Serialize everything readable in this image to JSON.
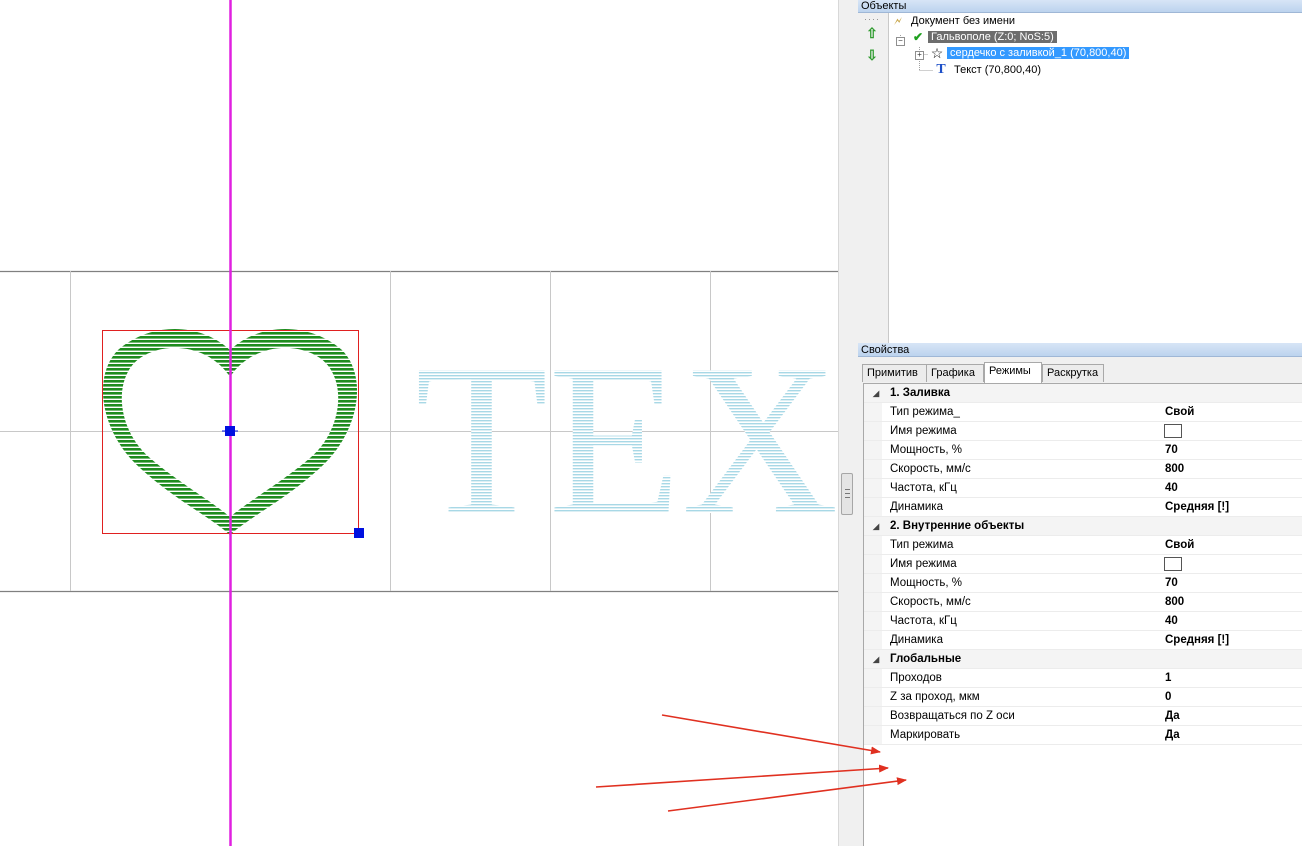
{
  "canvas": {
    "text_sample": "TEX"
  },
  "objects_panel": {
    "title": "Объекты",
    "tree": [
      {
        "label": "Документ без имени",
        "icon": "document-icon"
      },
      {
        "label": "Гальвополе (Z:0; NoS:5)",
        "icon": "checkmark-field-icon"
      },
      {
        "label": "сердечко с заливкой_1 (70,800,40)",
        "icon": "star-outline-icon"
      },
      {
        "label": "Текст (70,800,40)",
        "icon": "text-t-icon"
      }
    ]
  },
  "props_panel": {
    "title": "Свойства",
    "tabs": [
      "Примитив",
      "Графика",
      "Режимы",
      "Раскрутка"
    ],
    "active_tab": "Режимы",
    "rows": [
      {
        "type": "cat",
        "label": "1. Заливка"
      },
      {
        "type": "prop",
        "label": "Тип режима_",
        "value": "Свой"
      },
      {
        "type": "box",
        "label": "Имя режима",
        "value": ""
      },
      {
        "type": "prop",
        "label": "Мощность, %",
        "value": "70"
      },
      {
        "type": "prop",
        "label": "Скорость, мм/с",
        "value": "800"
      },
      {
        "type": "prop",
        "label": "Частота, кГц",
        "value": "40"
      },
      {
        "type": "prop",
        "label": "Динамика",
        "value": "Средняя [!]"
      },
      {
        "type": "cat",
        "label": "2. Внутренние объекты"
      },
      {
        "type": "prop",
        "label": "Тип режима",
        "value": "Свой"
      },
      {
        "type": "box",
        "label": "Имя режима",
        "value": ""
      },
      {
        "type": "prop",
        "label": "Мощность, %",
        "value": "70"
      },
      {
        "type": "prop",
        "label": "Скорость, мм/с",
        "value": "800"
      },
      {
        "type": "prop",
        "label": "Частота, кГц",
        "value": "40"
      },
      {
        "type": "prop",
        "label": "Динамика",
        "value": "Средняя [!]"
      },
      {
        "type": "cat",
        "label": "Глобальные"
      },
      {
        "type": "prop",
        "label": "Проходов",
        "value": "1"
      },
      {
        "type": "prop",
        "label": "Z за проход, мкм",
        "value": "0"
      },
      {
        "type": "prop",
        "label": "Возвращаться по Z оси",
        "value": "Да"
      },
      {
        "type": "prop",
        "label": "Маркировать",
        "value": "Да"
      }
    ]
  },
  "colors": {
    "axis_magenta": "#e020e0",
    "heart_green": "#1e8c1e",
    "text_fill_cyan": "#a8d8e6",
    "selection_red": "#e02020",
    "handle_blue": "#0010e0",
    "annotation_arrow": "#e03020"
  }
}
